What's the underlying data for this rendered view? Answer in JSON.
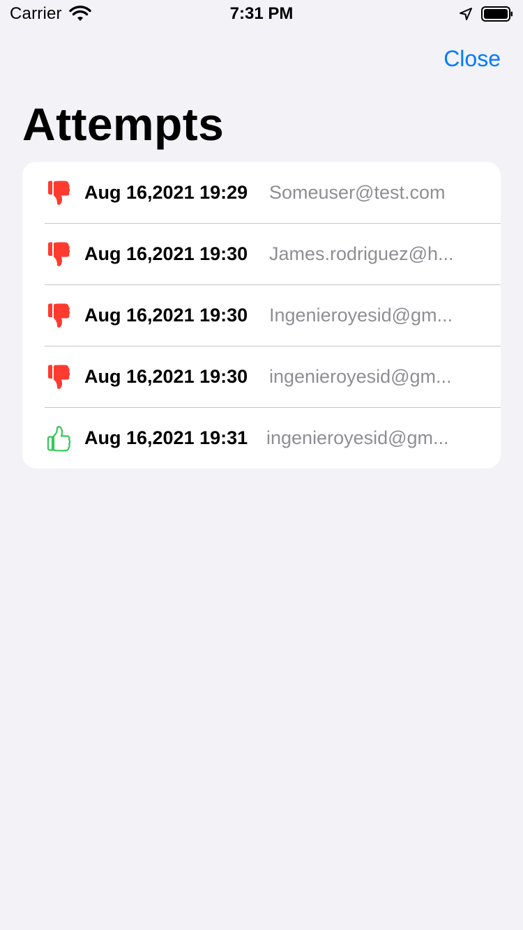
{
  "status_bar": {
    "carrier": "Carrier",
    "time": "7:31 PM",
    "icons": [
      "wifi-icon",
      "location-arrow-icon",
      "battery-icon"
    ]
  },
  "nav": {
    "close_label": "Close"
  },
  "page": {
    "title": "Attempts"
  },
  "attempts": [
    {
      "result": "failed",
      "icon": "thumbs-down-icon",
      "date": "Aug 16,2021 19:29",
      "email": "Someuser@test.com"
    },
    {
      "result": "failed",
      "icon": "thumbs-down-icon",
      "date": "Aug 16,2021 19:30",
      "email": "James.rodriguez@h..."
    },
    {
      "result": "failed",
      "icon": "thumbs-down-icon",
      "date": "Aug 16,2021 19:30",
      "email": "Ingenieroyesid@gm..."
    },
    {
      "result": "failed",
      "icon": "thumbs-down-icon",
      "date": "Aug 16,2021 19:30",
      "email": "ingenieroyesid@gm..."
    },
    {
      "result": "success",
      "icon": "thumbs-up-icon",
      "date": "Aug 16,2021 19:31",
      "email": "ingenieroyesid@gm..."
    }
  ],
  "colors": {
    "accent": "#007aff",
    "failed": "#ff3b30",
    "success": "#34c759",
    "background": "#f2f2f7",
    "secondary_text": "#8e8e93"
  }
}
